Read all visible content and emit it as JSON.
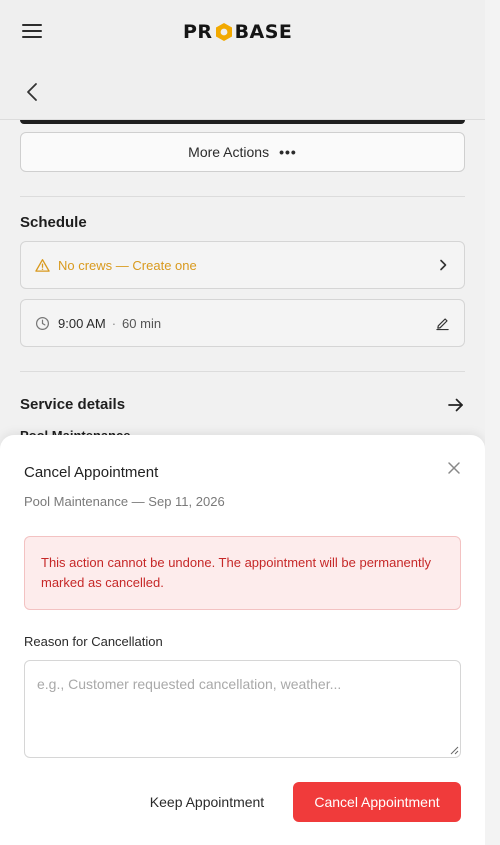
{
  "header": {
    "logo_text_left": "PR",
    "logo_text_right": "BASE"
  },
  "actions": {
    "more_actions_label": "More Actions",
    "more_actions_dots": "•••"
  },
  "schedule": {
    "title": "Schedule",
    "crew_warning": "No crews — Create one",
    "time": "9:00 AM",
    "separator": "·",
    "duration": "60 min"
  },
  "service": {
    "title": "Service details",
    "peek_text": "Pool Maintenance"
  },
  "modal": {
    "title": "Cancel Appointment",
    "subtitle": "Pool Maintenance — Sep 11, 2026",
    "alert_text": "This action cannot be undone. The appointment will be permanently marked as cancelled.",
    "reason_label": "Reason for Cancellation",
    "reason_value": "",
    "reason_placeholder": "e.g., Customer requested cancellation, weather...",
    "keep_label": "Keep Appointment",
    "confirm_label": "Cancel Appointment"
  },
  "colors": {
    "brand_yellow": "#f2a900",
    "warning": "#d99a1e",
    "danger": "#f03b3b",
    "danger_text": "#c62828"
  }
}
